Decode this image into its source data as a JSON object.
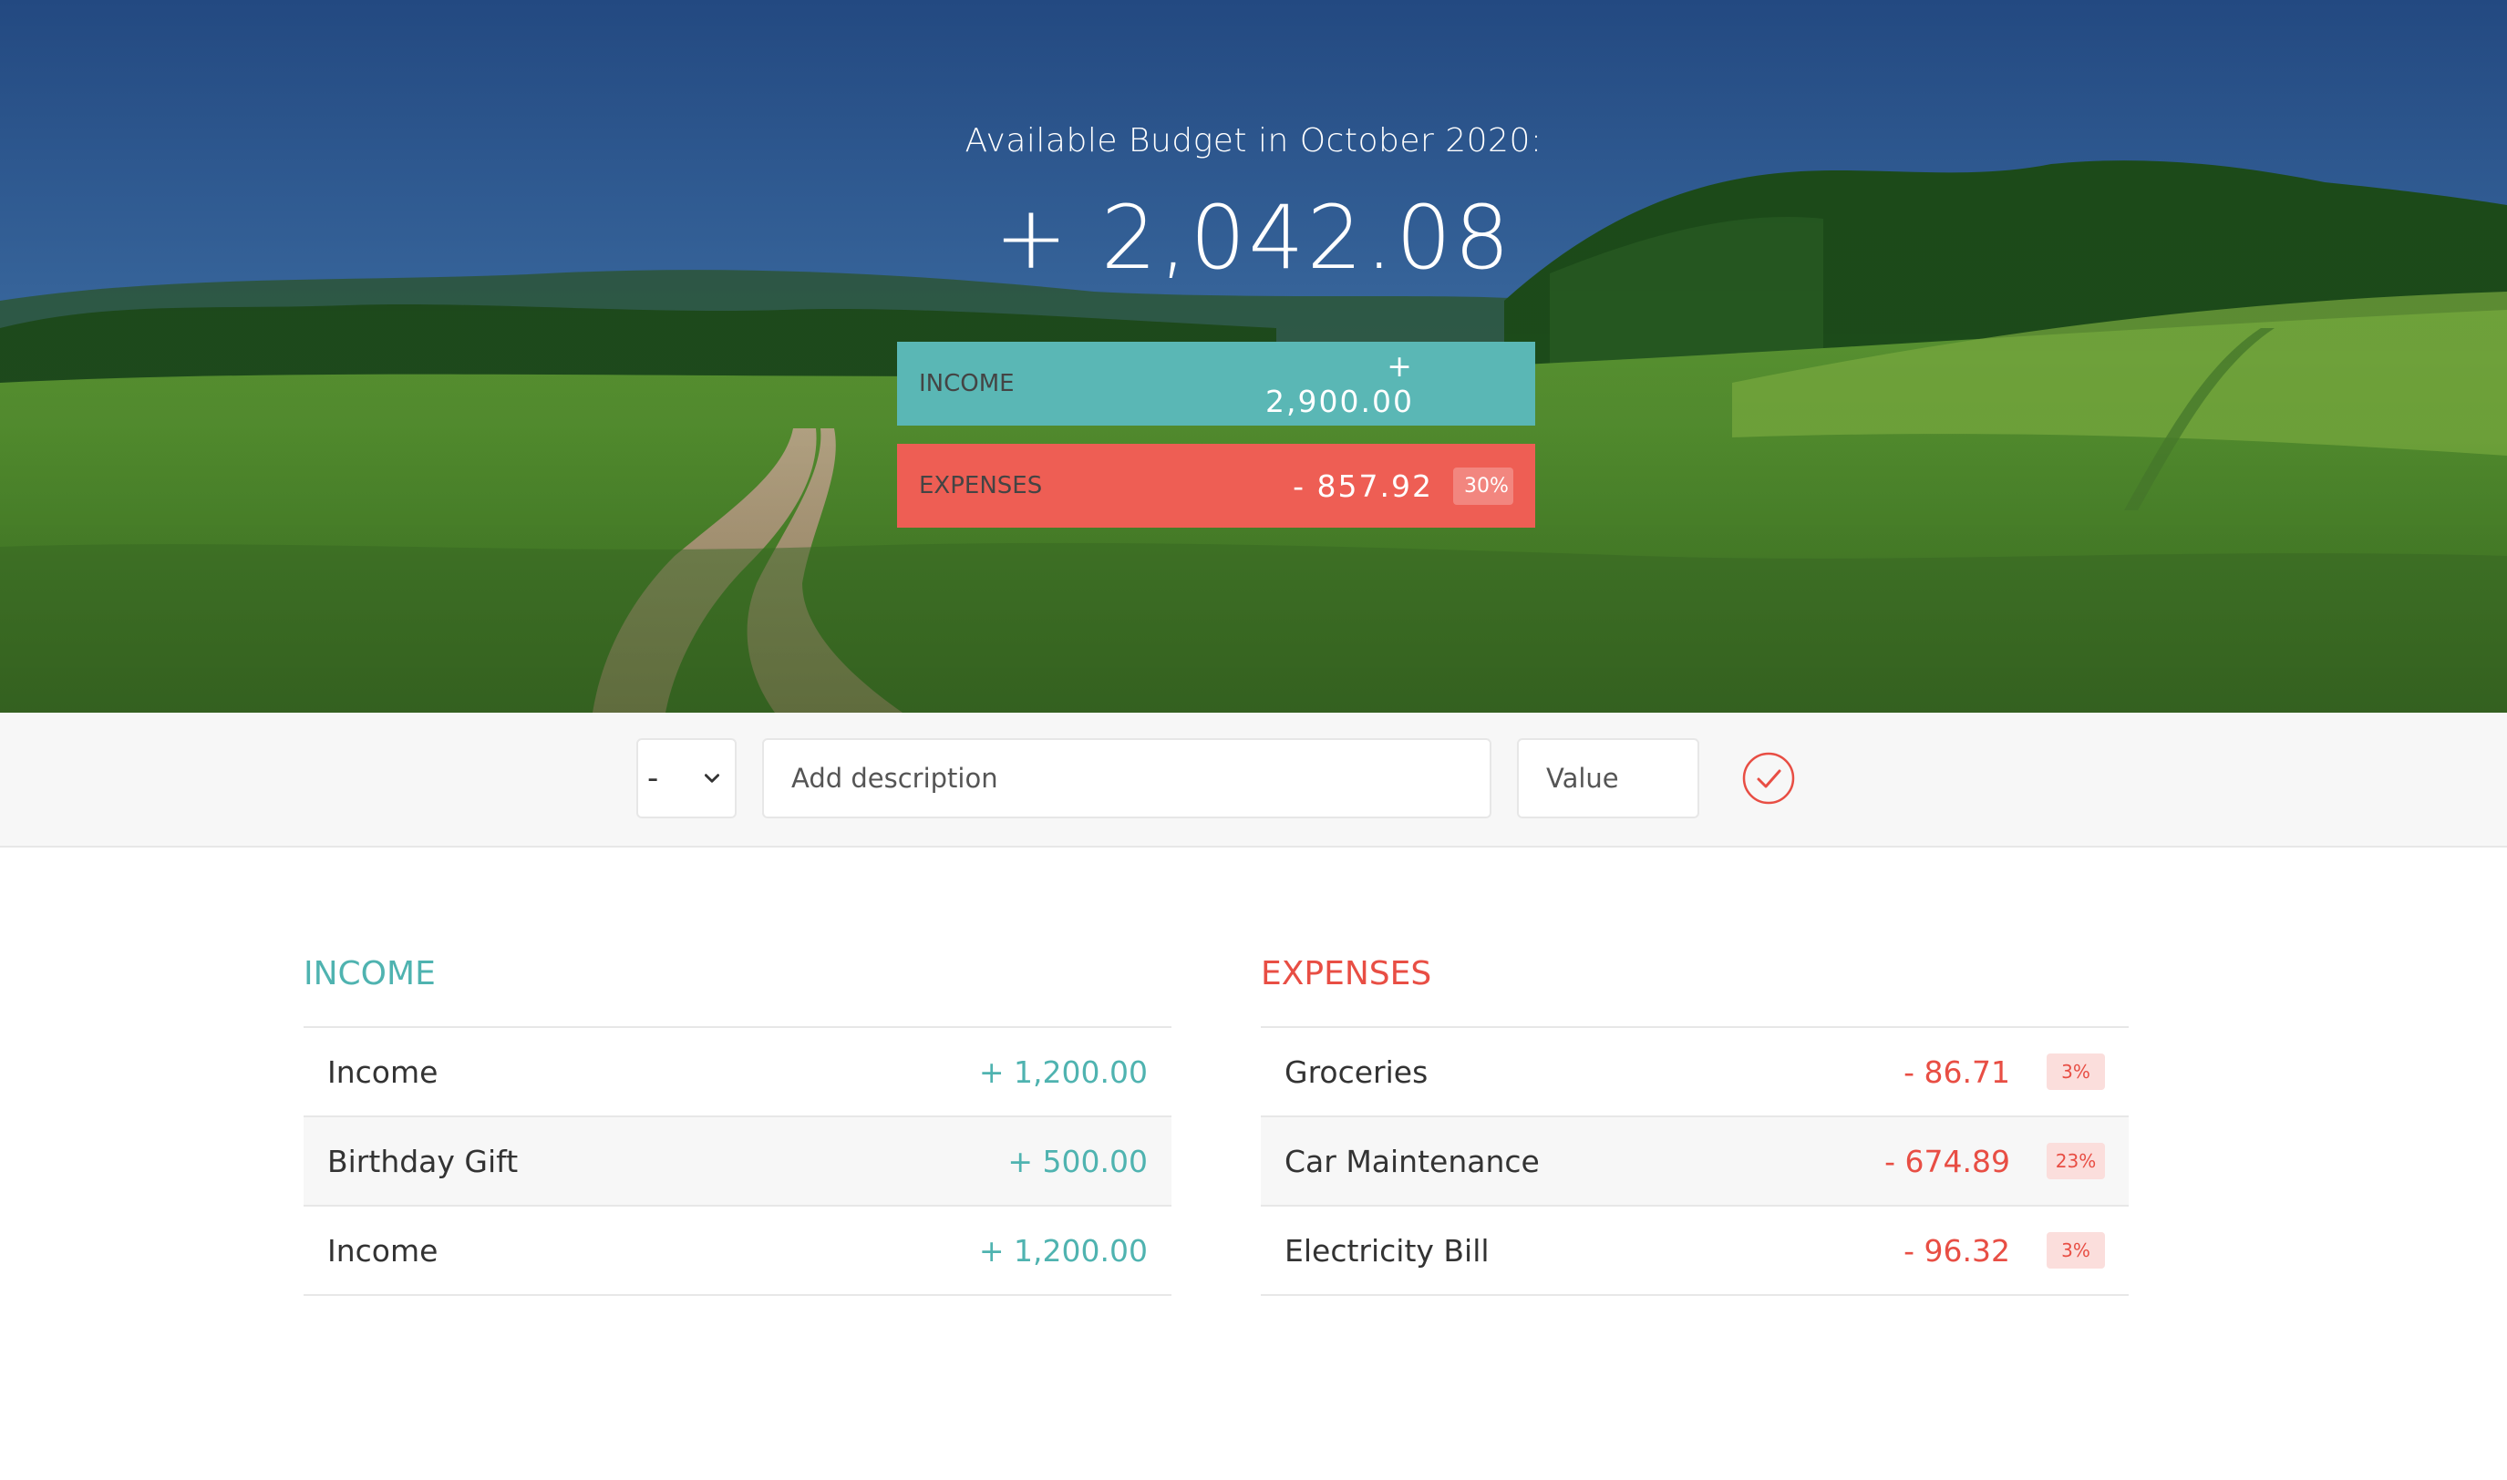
{
  "header": {
    "title": "Available Budget in October 2020:",
    "budget": "+ 2,042.08",
    "income": {
      "label": "Income",
      "value": "+ 2,900.00"
    },
    "expenses": {
      "label": "Expenses",
      "value": "- 857.92",
      "percentage": "30%"
    }
  },
  "add": {
    "type_selected": "-",
    "description_placeholder": "Add description",
    "value_placeholder": "Value",
    "submit_icon": "check-circle-icon"
  },
  "income_list": {
    "title": "Income",
    "items": [
      {
        "description": "Income",
        "value": "+ 1,200.00"
      },
      {
        "description": "Birthday Gift",
        "value": "+ 500.00"
      },
      {
        "description": "Income",
        "value": "+ 1,200.00"
      }
    ]
  },
  "expenses_list": {
    "title": "Expenses",
    "items": [
      {
        "description": "Groceries",
        "value": "- 86.71",
        "percentage": "3%"
      },
      {
        "description": "Car Maintenance",
        "value": "- 674.89",
        "percentage": "23%"
      },
      {
        "description": "Electricity Bill",
        "value": "- 96.32",
        "percentage": "3%"
      }
    ]
  },
  "colors": {
    "income": "#4fb3b0",
    "income_bar": "#5ab7b5",
    "expenses": "#e84e44",
    "expenses_bar": "#ee5e54"
  }
}
